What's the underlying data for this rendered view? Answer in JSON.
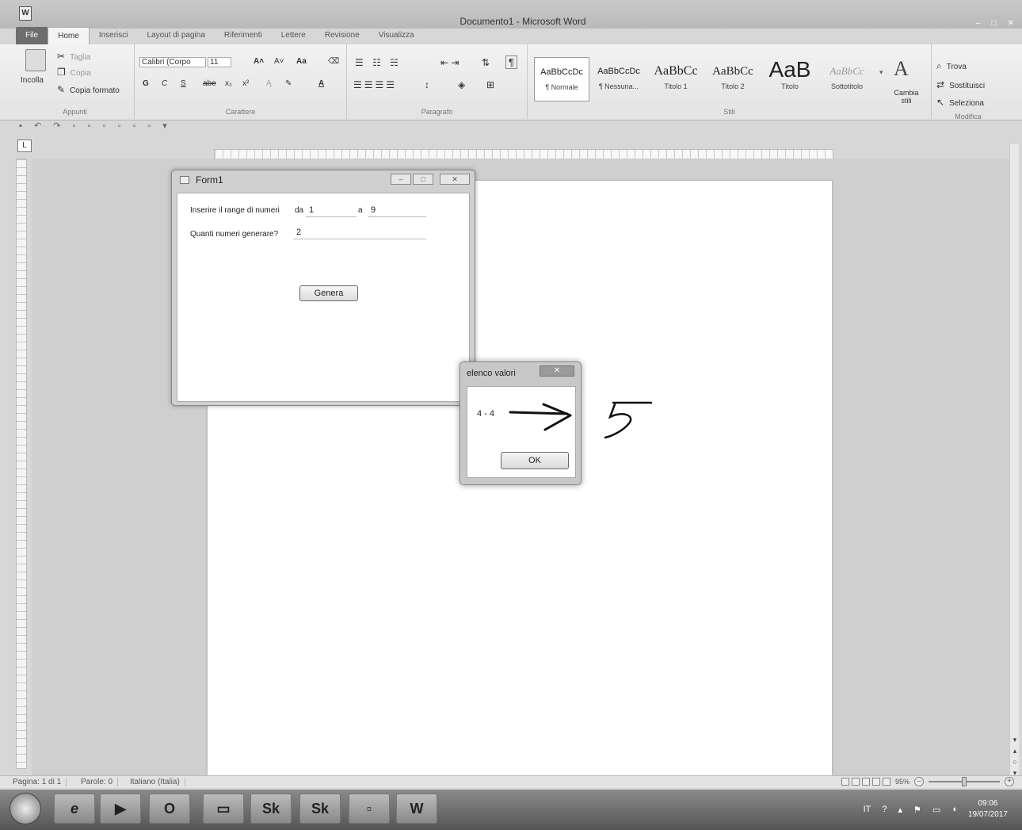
{
  "window": {
    "app_icon": "W",
    "title": "Documento1 - Microsoft Word",
    "controls": [
      "–",
      "□",
      "✕"
    ]
  },
  "ribbon_tabs": [
    "File",
    "Home",
    "Inserisci",
    "Layout di pagina",
    "Riferimenti",
    "Lettere",
    "Revisione",
    "Visualizza"
  ],
  "clipboard": {
    "paste": "Incolla",
    "cut": "Taglia",
    "copy": "Copia",
    "format_painter": "Copia formato",
    "label": "Appunti"
  },
  "font": {
    "name": "Calibri (Corpo",
    "size": "11",
    "grow": "A˄",
    "shrink": "A˅",
    "case": "Aa",
    "bold": "G",
    "italic": "C",
    "underline": "S",
    "strike": "abe",
    "sub": "x₂",
    "sup": "x²",
    "color": "A",
    "label": "Carattere"
  },
  "paragraph": {
    "label": "Paragrafo"
  },
  "styles": {
    "items": [
      {
        "sample": "AaBbCcDc",
        "name": "¶ Normale"
      },
      {
        "sample": "AaBbCcDc",
        "name": "¶ Nessuna..."
      },
      {
        "sample": "AaBbCc",
        "name": "Titolo 1"
      },
      {
        "sample": "AaBbCc",
        "name": "Titolo 2"
      },
      {
        "sample": "AaB",
        "name": "Titolo"
      },
      {
        "sample": "AaBbCc",
        "name": "Sottotitolo"
      }
    ],
    "change": "Cambia stili",
    "label": "Stili"
  },
  "editing": {
    "find": "Trova",
    "replace": "Sostituisci",
    "select": "Seleziona",
    "label": "Modifica"
  },
  "ruler_corner": "L",
  "status": {
    "page": "Pagina: 1 di 1",
    "words": "Parole: 0",
    "language": "Italiano (Italia)",
    "zoom": "95%"
  },
  "taskbar": {
    "apps": [
      "e",
      "▶",
      "O",
      "▭",
      "Sk",
      "Sk",
      "▫",
      "W"
    ],
    "lang": "IT",
    "time": "09:06",
    "date": "19/07/2017"
  },
  "form1": {
    "title": "Form1",
    "range_label": "Inserire il range di numeri",
    "from_label": "da",
    "from_value": "1",
    "to_label": "a",
    "to_value": "9",
    "count_label": "Quanti numeri generare?",
    "count_value": "2",
    "button": "Genera"
  },
  "msgbox": {
    "title": "elenco valori",
    "close": "✕",
    "text": "4 - 4",
    "ok": "OK"
  }
}
